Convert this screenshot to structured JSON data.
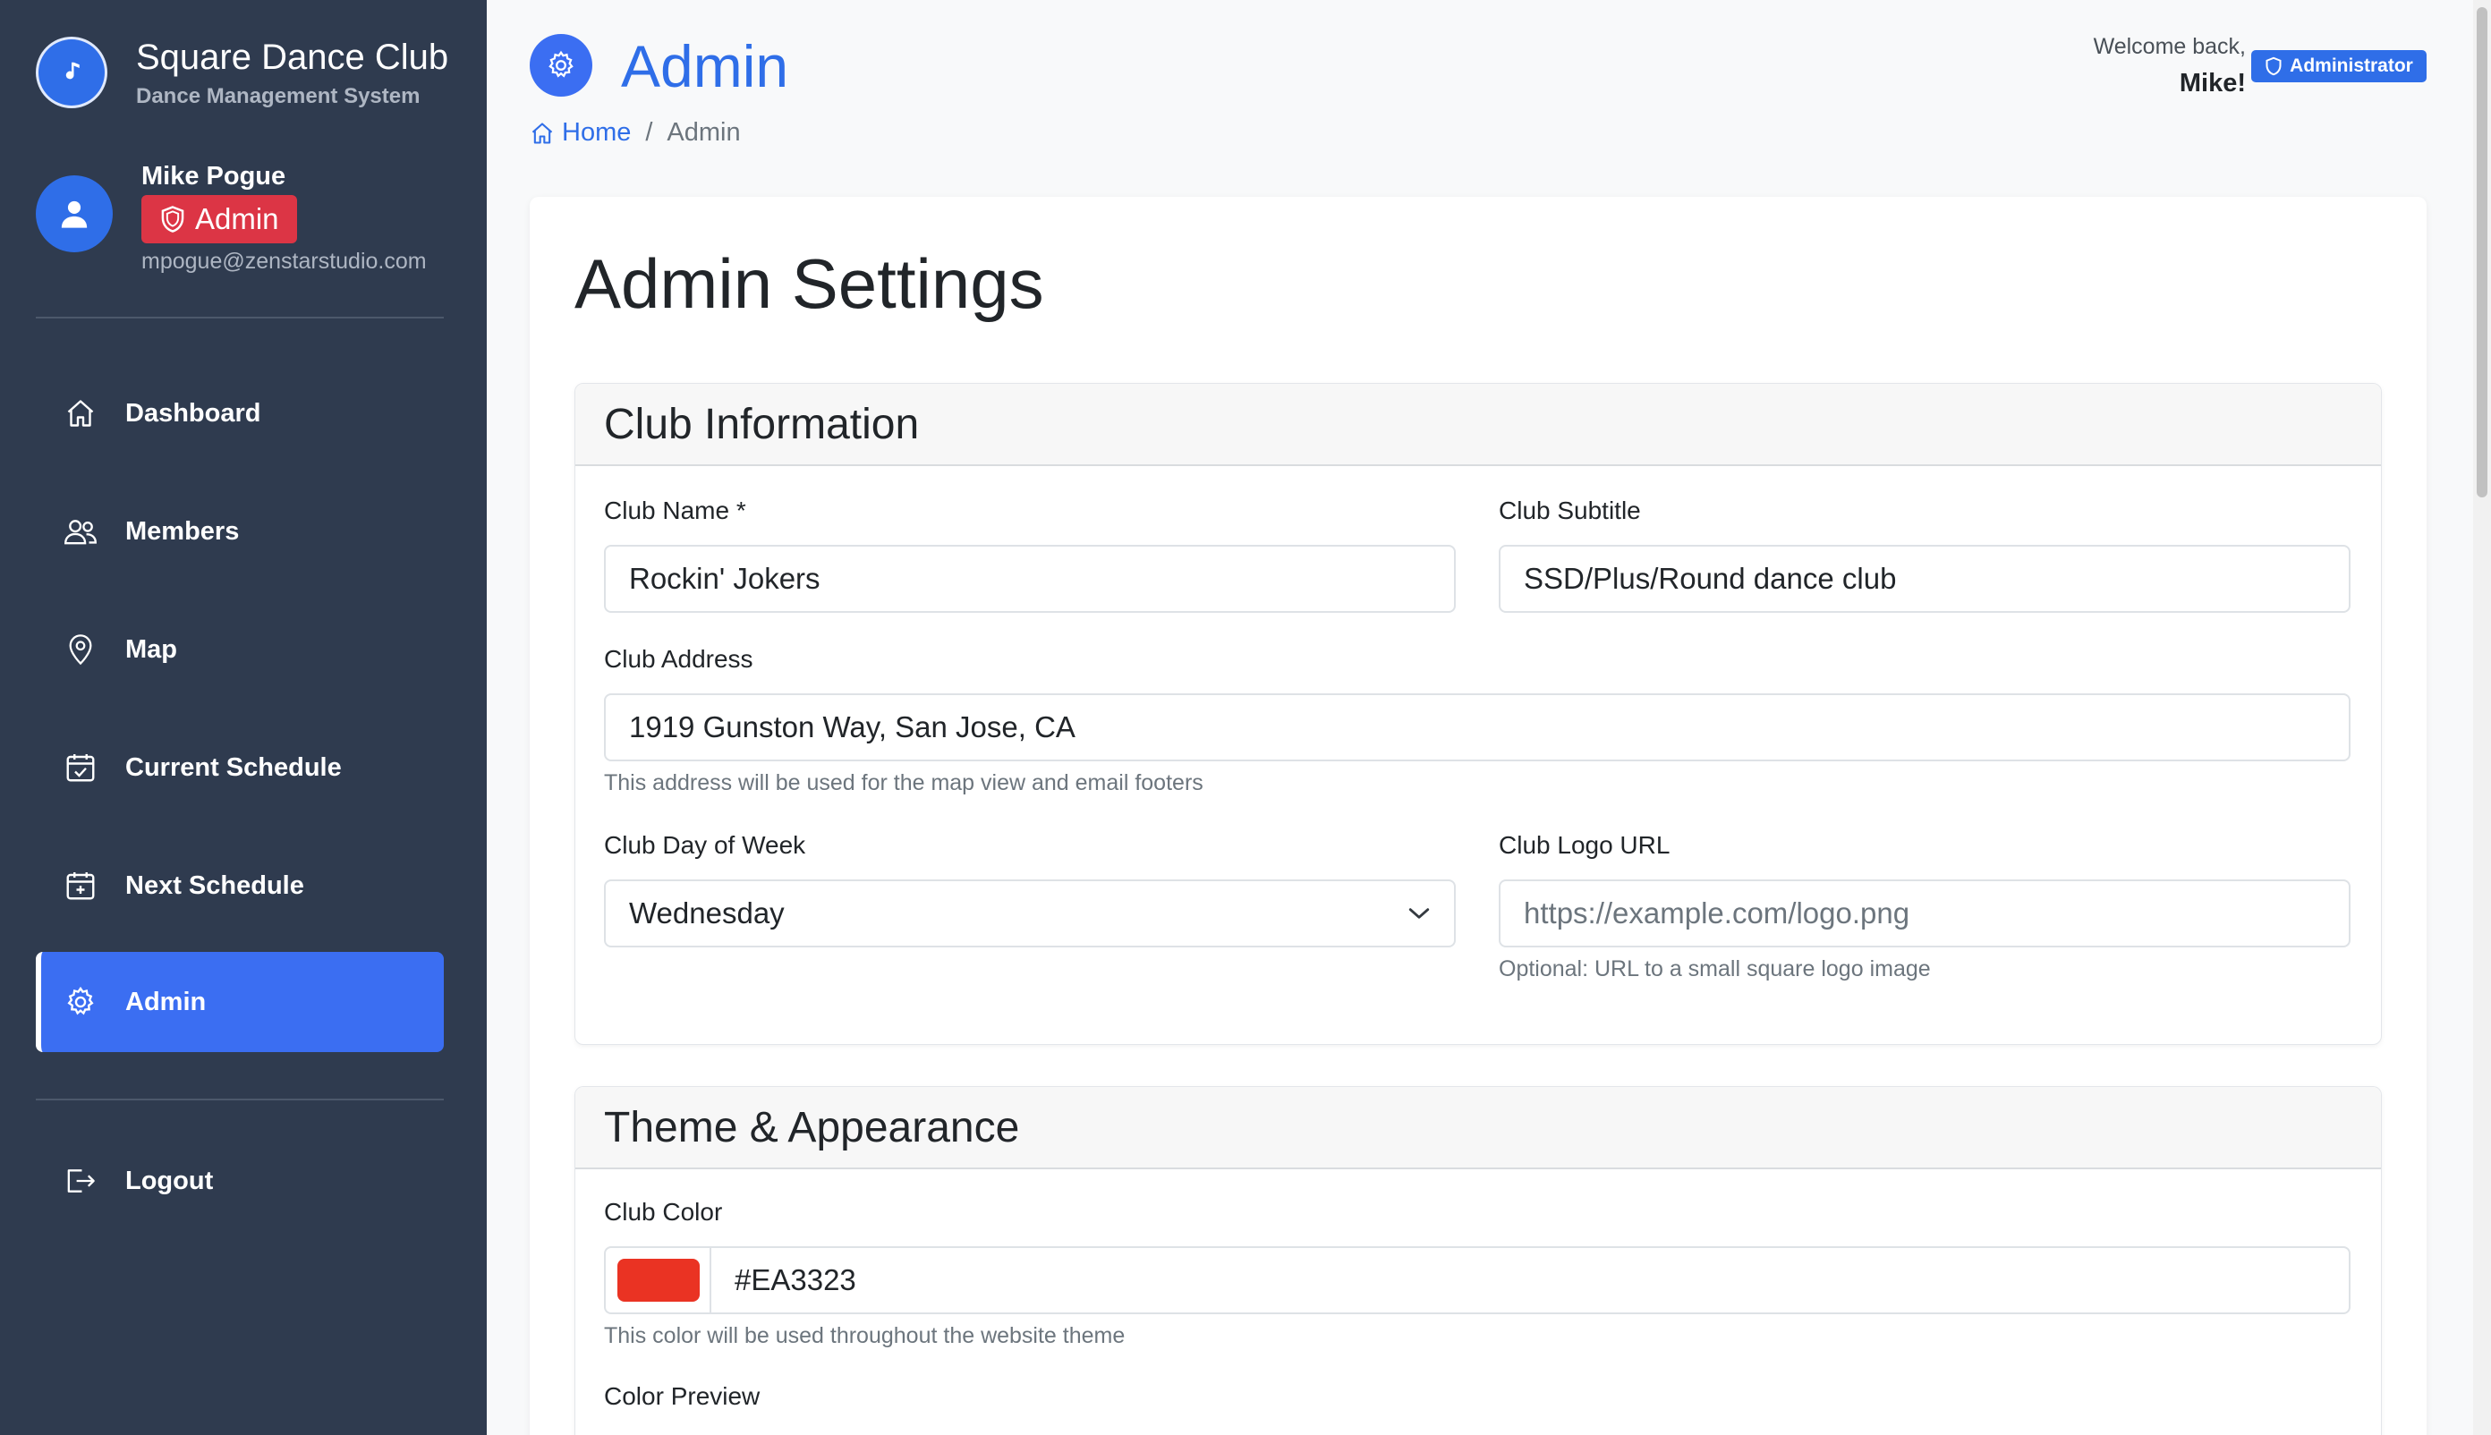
{
  "brand": {
    "title": "Square Dance Club",
    "subtitle": "Dance Management System"
  },
  "user": {
    "name": "Mike Pogue",
    "role": "Admin",
    "email": "mpogue@zenstarstudio.com"
  },
  "nav": {
    "items": [
      {
        "label": "Dashboard",
        "icon": "house-icon"
      },
      {
        "label": "Members",
        "icon": "people-icon"
      },
      {
        "label": "Map",
        "icon": "map-pin-icon"
      },
      {
        "label": "Current Schedule",
        "icon": "calendar-check-icon"
      },
      {
        "label": "Next Schedule",
        "icon": "calendar-plus-icon"
      },
      {
        "label": "Admin",
        "icon": "gear-icon",
        "active": true
      }
    ],
    "logout": "Logout"
  },
  "header": {
    "title": "Admin",
    "breadcrumb": {
      "home": "Home",
      "separator": "/",
      "current": "Admin"
    },
    "welcome": "Welcome back,",
    "welcome_name": "Mike!",
    "role_pill": "Administrator"
  },
  "settings": {
    "title": "Admin Settings",
    "club_info": {
      "header": "Club Information",
      "club_name_label": "Club Name *",
      "club_name_value": "Rockin' Jokers",
      "club_subtitle_label": "Club Subtitle",
      "club_subtitle_value": "SSD/Plus/Round dance club",
      "club_address_label": "Club Address",
      "club_address_value": "1919 Gunston Way, San Jose, CA",
      "club_address_help": "This address will be used for the map view and email footers",
      "club_day_label": "Club Day of Week",
      "club_day_value": "Wednesday",
      "club_logo_label": "Club Logo URL",
      "club_logo_placeholder": "https://example.com/logo.png",
      "club_logo_help": "Optional: URL to a small square logo image"
    },
    "theme": {
      "header": "Theme & Appearance",
      "club_color_label": "Club Color",
      "club_color_value": "#EA3323",
      "club_color_help": "This color will be used throughout the website theme",
      "color_preview_label": "Color Preview"
    }
  },
  "colors": {
    "sidebar_bg": "#2f3b4f",
    "accent": "#3b6ef2",
    "danger": "#dc3545",
    "club_color": "#EA3323"
  }
}
